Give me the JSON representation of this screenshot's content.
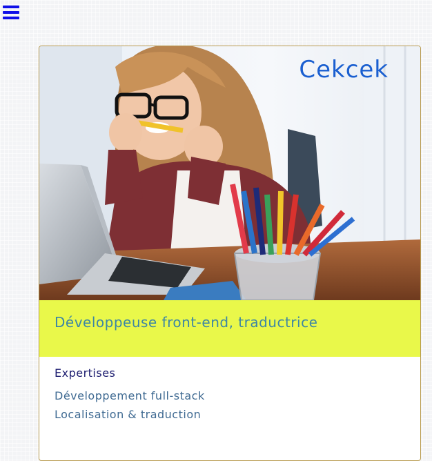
{
  "nav": {
    "menu_icon": "hamburger-menu-icon",
    "menu_color": "#1010e8"
  },
  "hero": {
    "brand": "Cekcek",
    "image_subject": "woman biting a pencil while looking at a laptop, pencil cup on desk"
  },
  "tagline": "Développeuse front-end, traductrice",
  "expertise": {
    "title": "Expertises",
    "items": [
      "Développement full-stack",
      "Localisation & traduction"
    ]
  },
  "colors": {
    "accent_band": "#e9f84a",
    "brand": "#1a5fd0",
    "tagline": "#3d86a4",
    "heading": "#1a1a6e",
    "list_text": "#3f6a92",
    "card_border": "#b89a4e"
  }
}
